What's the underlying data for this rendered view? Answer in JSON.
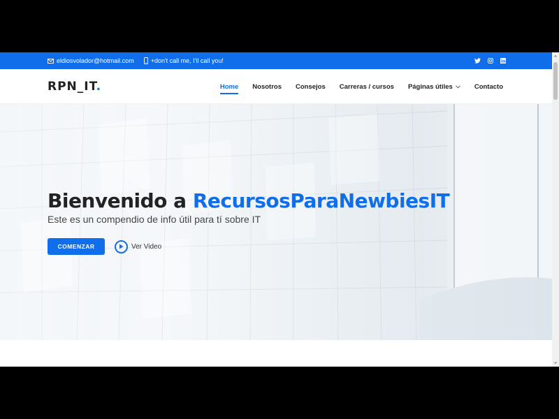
{
  "topbar": {
    "email": "eldiosvolador@hotmail.com",
    "phone": "+don't call me, I'll call you!",
    "social": [
      "twitter-icon",
      "instagram-icon",
      "linkedin-icon"
    ]
  },
  "header": {
    "logo": "RPN_IT",
    "logo_dot": ".",
    "nav": [
      {
        "label": "Home",
        "active": true
      },
      {
        "label": "Nosotros"
      },
      {
        "label": "Consejos"
      },
      {
        "label": "Carreras / cursos"
      },
      {
        "label": "Páginas útiles",
        "dropdown": true
      },
      {
        "label": "Contacto"
      }
    ]
  },
  "hero": {
    "title_prefix": "Bienvenido a ",
    "title_brand": "RecursosParaNewbiesIT",
    "subtitle": "Este es un compendio de info útil para tí sobre IT",
    "cta_label": "COMENZAR",
    "video_label": "Ver Video"
  },
  "colors": {
    "accent": "#106eea",
    "text": "#222222"
  }
}
